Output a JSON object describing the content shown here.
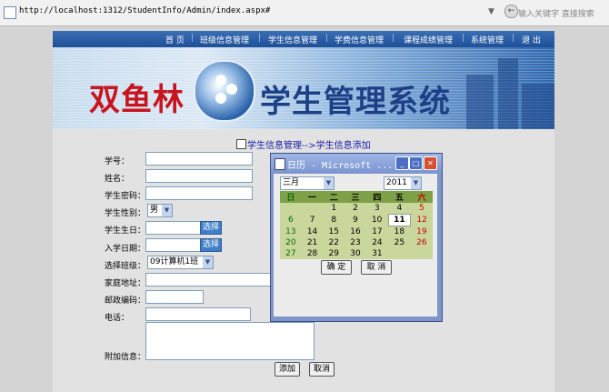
{
  "browser": {
    "url": "http://localhost:1312/StudentInfo/Admin/index.aspx#",
    "search_placeholder": "输入关键字 直接搜索"
  },
  "nav": {
    "items": [
      "首  页",
      "班级信息管理",
      "学生信息管理",
      "学费信息管理",
      "课程成绩管理",
      "系统管理",
      "退  出"
    ],
    "separator": "|"
  },
  "banner": {
    "left_text": "双鱼林",
    "right_text": "学生管理系统"
  },
  "form": {
    "heading": "学生信息管理-->学生信息添加",
    "labels": {
      "student_no": "学号：",
      "name": "姓名：",
      "password": "学生密码：",
      "gender": "学生性别：",
      "birthday": "学生生日：",
      "enroll_date": "入学日期：",
      "class": "选择班级：",
      "address": "家庭地址：",
      "postcode": "邮政编码：",
      "phone": "电话：",
      "extra": "附加信息："
    },
    "gender_value": "男",
    "class_value": "09计算机1班",
    "pick_label": "选择",
    "add_label": "添加",
    "cancel_label": "取消"
  },
  "calendar": {
    "window_title": "日历 - Microsoft ...",
    "month_value": "三月",
    "year_value": "2011",
    "weekdays": [
      "日",
      "一",
      "二",
      "三",
      "四",
      "五",
      "六"
    ],
    "weeks": [
      [
        "",
        "",
        "1",
        "2",
        "3",
        "4",
        "5"
      ],
      [
        "6",
        "7",
        "8",
        "9",
        "10",
        "11",
        "12"
      ],
      [
        "13",
        "14",
        "15",
        "16",
        "17",
        "18",
        "19"
      ],
      [
        "20",
        "21",
        "22",
        "23",
        "24",
        "25",
        "26"
      ],
      [
        "27",
        "28",
        "29",
        "30",
        "31",
        "",
        ""
      ]
    ],
    "today": "11",
    "ok_label": "确 定",
    "cancel_label": "取 消"
  },
  "colors": {
    "nav_bg": "#1e4f98",
    "banner_red": "#c8141e",
    "banner_blue": "#1d3f86",
    "calendar_header": "#7ea046",
    "calendar_cell": "#c9d79c",
    "link_blue": "#1a1aa8"
  }
}
